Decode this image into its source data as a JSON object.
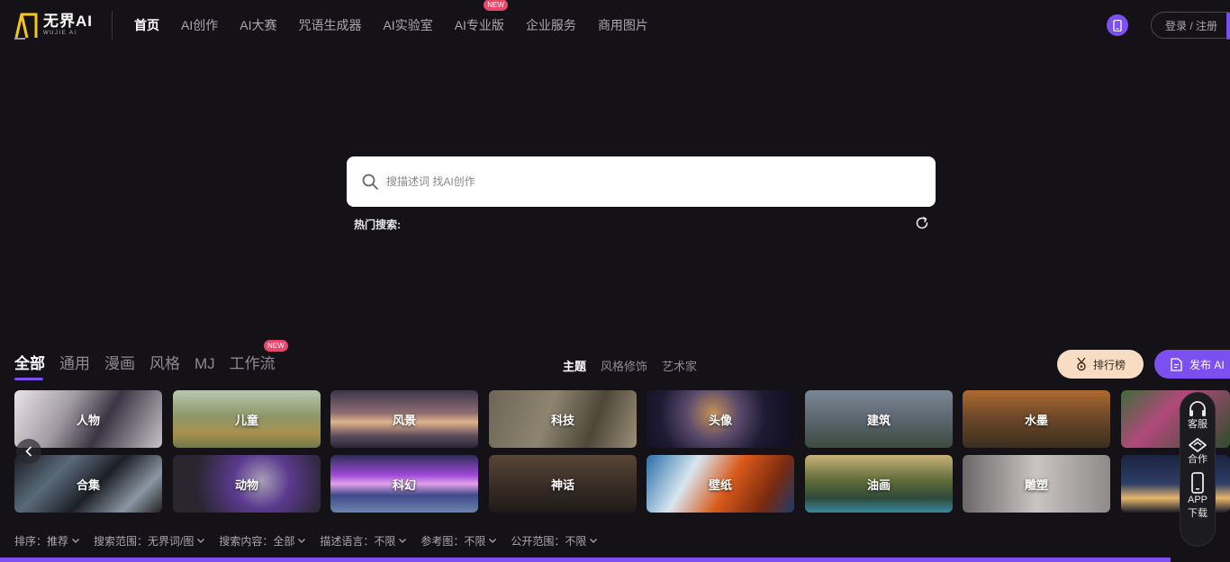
{
  "brand": {
    "logo_main": "无界AI",
    "logo_sub": "WUJIE AI",
    "accent_color": "#7b4ff0"
  },
  "nav": {
    "items": [
      {
        "label": "首页",
        "active": true
      },
      {
        "label": "AI创作"
      },
      {
        "label": "AI大赛"
      },
      {
        "label": "咒语生成器"
      },
      {
        "label": "AI实验室"
      },
      {
        "label": "AI专业版",
        "badge": "NEW"
      },
      {
        "label": "企业服务"
      },
      {
        "label": "商用图片"
      }
    ],
    "login_label": "登录 / 注册"
  },
  "search": {
    "placeholder": "搜描述词 找AI创作",
    "hot_label": "热门搜索:"
  },
  "categories": {
    "tabs": [
      {
        "label": "全部",
        "active": true
      },
      {
        "label": "通用"
      },
      {
        "label": "漫画"
      },
      {
        "label": "风格"
      },
      {
        "label": "MJ"
      },
      {
        "label": "工作流",
        "badge": "NEW"
      }
    ],
    "sub_tabs": [
      {
        "label": "主题",
        "active": true
      },
      {
        "label": "风格修饰"
      },
      {
        "label": "艺术家"
      }
    ],
    "rank_label": "排行榜",
    "publish_label": "发布 AI"
  },
  "tiles": {
    "row1": [
      "人物",
      "儿童",
      "风景",
      "科技",
      "头像",
      "建筑",
      "水墨",
      ""
    ],
    "row2": [
      "合集",
      "动物",
      "科幻",
      "神话",
      "壁纸",
      "油画",
      "雕塑",
      ""
    ]
  },
  "float_panel": {
    "service_label": "客服",
    "coop_label": "合作",
    "app_label_1": "APP",
    "app_label_2": "下载"
  },
  "filters": [
    "排序：推荐",
    "搜索范围：无界词/图",
    "搜索内容：全部",
    "描述语言：不限",
    "参考图：不限",
    "公开范围：不限"
  ]
}
